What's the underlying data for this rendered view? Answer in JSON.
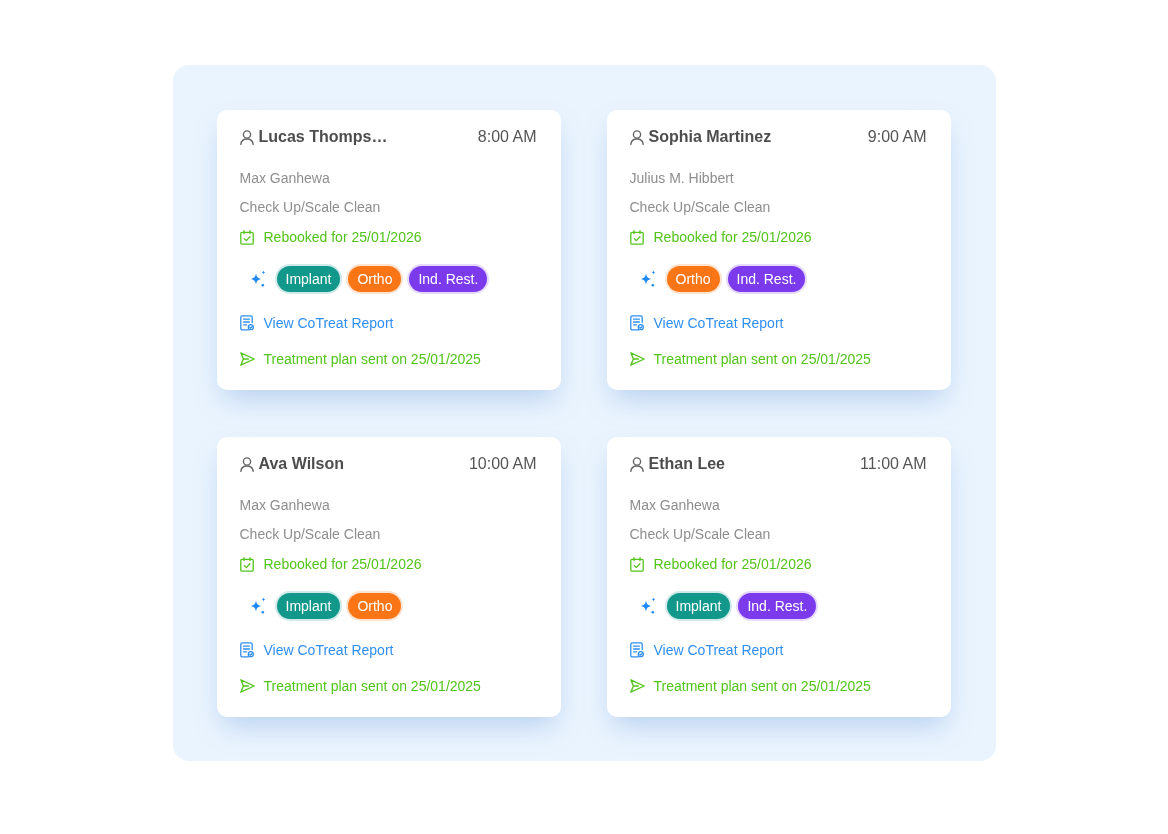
{
  "appointments": [
    {
      "patient": "Lucas Thomps…",
      "time": "8:00 AM",
      "provider": "Max Ganhewa",
      "procedure": "Check Up/Scale Clean",
      "rebooked": "Rebooked for 25/01/2026",
      "tags": [
        {
          "label": "Implant",
          "color": "#11988b"
        },
        {
          "label": "Ortho",
          "color": "#fa7516"
        },
        {
          "label": "Ind. Rest.",
          "color": "#7c3aed"
        }
      ],
      "report_link": "View CoTreat Report",
      "plan_status": "Treatment plan sent on 25/01/2025"
    },
    {
      "patient": "Sophia Martinez",
      "time": "9:00 AM",
      "provider": "Julius M. Hibbert",
      "procedure": "Check Up/Scale Clean",
      "rebooked": "Rebooked for 25/01/2026",
      "tags": [
        {
          "label": "Ortho",
          "color": "#fa7516"
        },
        {
          "label": "Ind. Rest.",
          "color": "#7c3aed"
        }
      ],
      "report_link": "View CoTreat Report",
      "plan_status": "Treatment plan sent on 25/01/2025"
    },
    {
      "patient": "Ava Wilson",
      "time": "10:00 AM",
      "provider": "Max Ganhewa",
      "procedure": "Check Up/Scale Clean",
      "rebooked": "Rebooked for 25/01/2026",
      "tags": [
        {
          "label": "Implant",
          "color": "#11988b"
        },
        {
          "label": "Ortho",
          "color": "#fa7516"
        }
      ],
      "report_link": "View CoTreat Report",
      "plan_status": "Treatment plan sent on 25/01/2025"
    },
    {
      "patient": "Ethan Lee",
      "time": "11:00 AM",
      "provider": "Max Ganhewa",
      "procedure": "Check Up/Scale Clean",
      "rebooked": "Rebooked for 25/01/2026",
      "tags": [
        {
          "label": "Implant",
          "color": "#11988b"
        },
        {
          "label": "Ind. Rest.",
          "color": "#7c3aed"
        }
      ],
      "report_link": "View CoTreat Report",
      "plan_status": "Treatment plan sent on 25/01/2025"
    }
  ]
}
